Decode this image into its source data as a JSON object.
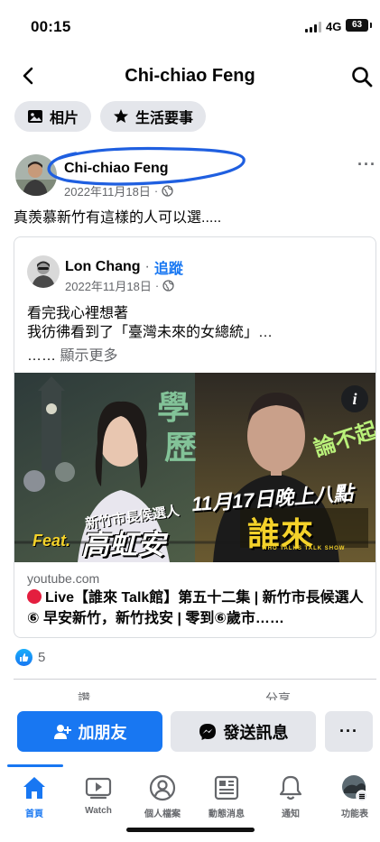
{
  "status_bar": {
    "time": "00:15",
    "network": "4G",
    "battery": "63"
  },
  "header": {
    "title": "Chi-chiao Feng"
  },
  "chips": [
    {
      "label": "相片",
      "icon": "photo-icon"
    },
    {
      "label": "生活要事",
      "icon": "star-icon"
    }
  ],
  "post": {
    "author": "Chi-chiao Feng",
    "date": "2022年11月18日",
    "dot": "·",
    "more": "···",
    "text": "真羨慕新竹有這樣的人可以選.....",
    "shared": {
      "author": "Lon Chang",
      "dot": "·",
      "follow": "追蹤",
      "date": "2022年11月18日",
      "line1": "看完我心裡想著",
      "line2": "我彷彿看到了「臺灣未來的女總統」…",
      "ellipsis": "……",
      "see_more": "顯示更多",
      "thumbnail": {
        "info": "i",
        "feat": "Feat.",
        "role": "新竹市長候選人",
        "name": "高虹安",
        "date": "11月17日晚上八點",
        "show": "誰來ᴛᴀʟᴋ館",
        "show_sub": "WHO TALKS TALK SHOW",
        "xue": "學",
        "li": "歷",
        "lun": "論不起"
      },
      "link_domain": "youtube.com",
      "link_title": "Live【誰來 Talk館】第五十二集 | 新竹市長候選人⑥ 早安新竹，新竹找安 | 零到⑥歲市……"
    },
    "reactions_count": "5",
    "peek_left": "讚",
    "peek_right": "分享"
  },
  "actions": {
    "add_friend": "加朋友",
    "message": "發送訊息",
    "more": "···"
  },
  "tabs": [
    {
      "label": "首頁",
      "icon": "home-icon",
      "active": true
    },
    {
      "label": "Watch",
      "icon": "video-icon"
    },
    {
      "label": "個人檔案",
      "icon": "profile-icon"
    },
    {
      "label": "動態消息",
      "icon": "news-icon"
    },
    {
      "label": "通知",
      "icon": "bell-icon"
    },
    {
      "label": "功能表",
      "icon": "menu-avatar-icon"
    }
  ],
  "colors": {
    "accent": "#1877f2",
    "annotation": "#1f5fe0",
    "live": "#e41e3f"
  }
}
